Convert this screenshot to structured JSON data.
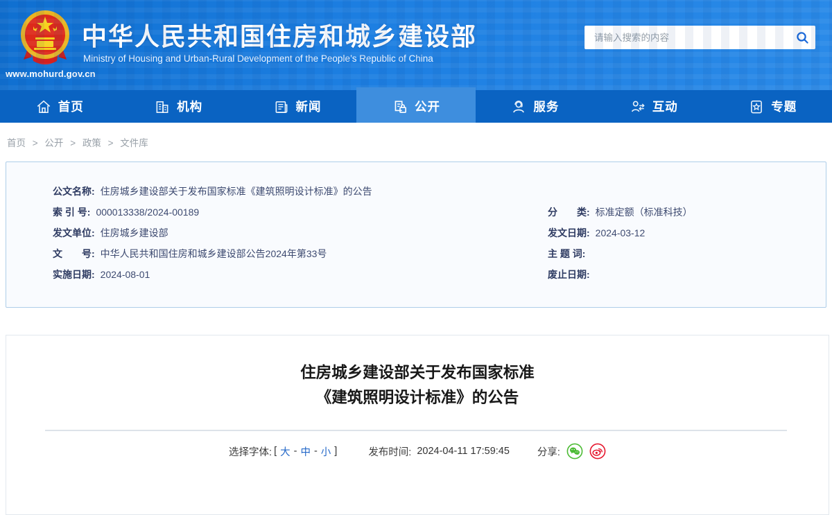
{
  "header": {
    "site_url": "www.mohurd.gov.cn",
    "title_cn": "中华人民共和国住房和城乡建设部",
    "title_en": "Ministry of Housing and Urban-Rural Development of the People’s Republic of China",
    "search": {
      "placeholder": "请输入搜索的内容",
      "icon": "search-icon"
    }
  },
  "nav": {
    "items": [
      {
        "label": "首页",
        "icon": "home-icon",
        "active": false
      },
      {
        "label": "机构",
        "icon": "organization-icon",
        "active": false
      },
      {
        "label": "新闻",
        "icon": "news-icon",
        "active": false
      },
      {
        "label": "公开",
        "icon": "disclosure-icon",
        "active": true
      },
      {
        "label": "服务",
        "icon": "service-icon",
        "active": false
      },
      {
        "label": "互动",
        "icon": "interaction-icon",
        "active": false
      },
      {
        "label": "专题",
        "icon": "topics-icon",
        "active": false
      }
    ]
  },
  "breadcrumb": {
    "separator": ">",
    "items": [
      "首页",
      "公开",
      "政策",
      "文件库"
    ]
  },
  "doc_meta": {
    "name_row": {
      "label": "公文名称:",
      "value": "住房城乡建设部关于发布国家标准《建筑照明设计标准》的公告"
    },
    "left_rows": [
      {
        "label": "索 引 号:",
        "value": "000013338/2024-00189"
      },
      {
        "label": "发文单位:",
        "value": "住房城乡建设部"
      },
      {
        "label": "文　　号:",
        "value": "中华人民共和国住房和城乡建设部公告2024年第33号"
      },
      {
        "label": "实施日期:",
        "value": "2024-08-01"
      }
    ],
    "right_rows": [
      {
        "label": "分　　类:",
        "value": "标准定额（标准科技）"
      },
      {
        "label": "发文日期:",
        "value": "2024-03-12"
      },
      {
        "label": "主 题 词:",
        "value": ""
      },
      {
        "label": "废止日期:",
        "value": ""
      }
    ]
  },
  "article": {
    "title_line1": "住房城乡建设部关于发布国家标准",
    "title_line2": "《建筑照明设计标准》的公告",
    "font_select": {
      "label": "选择字体:",
      "bracket_open": "[",
      "large": "大",
      "dash1": "-",
      "medium": "中",
      "dash2": "-",
      "small": "小",
      "bracket_close": "]"
    },
    "publish": {
      "label": "发布时间:",
      "value": "2024-04-11 17:59:45"
    },
    "share": {
      "label": "分享:",
      "icons": [
        "wechat-icon",
        "weibo-icon"
      ]
    }
  },
  "colors": {
    "header_blue": "#1d7fe2",
    "nav_blue": "#0a63c2",
    "nav_active_blue": "#3e8ede",
    "link_blue": "#2468c8",
    "meta_border": "#aecde9",
    "meta_bg": "#f9fbfe",
    "meta_text": "#2e3b62",
    "wechat_green": "#4cbb34",
    "weibo_red": "#e6162d"
  }
}
